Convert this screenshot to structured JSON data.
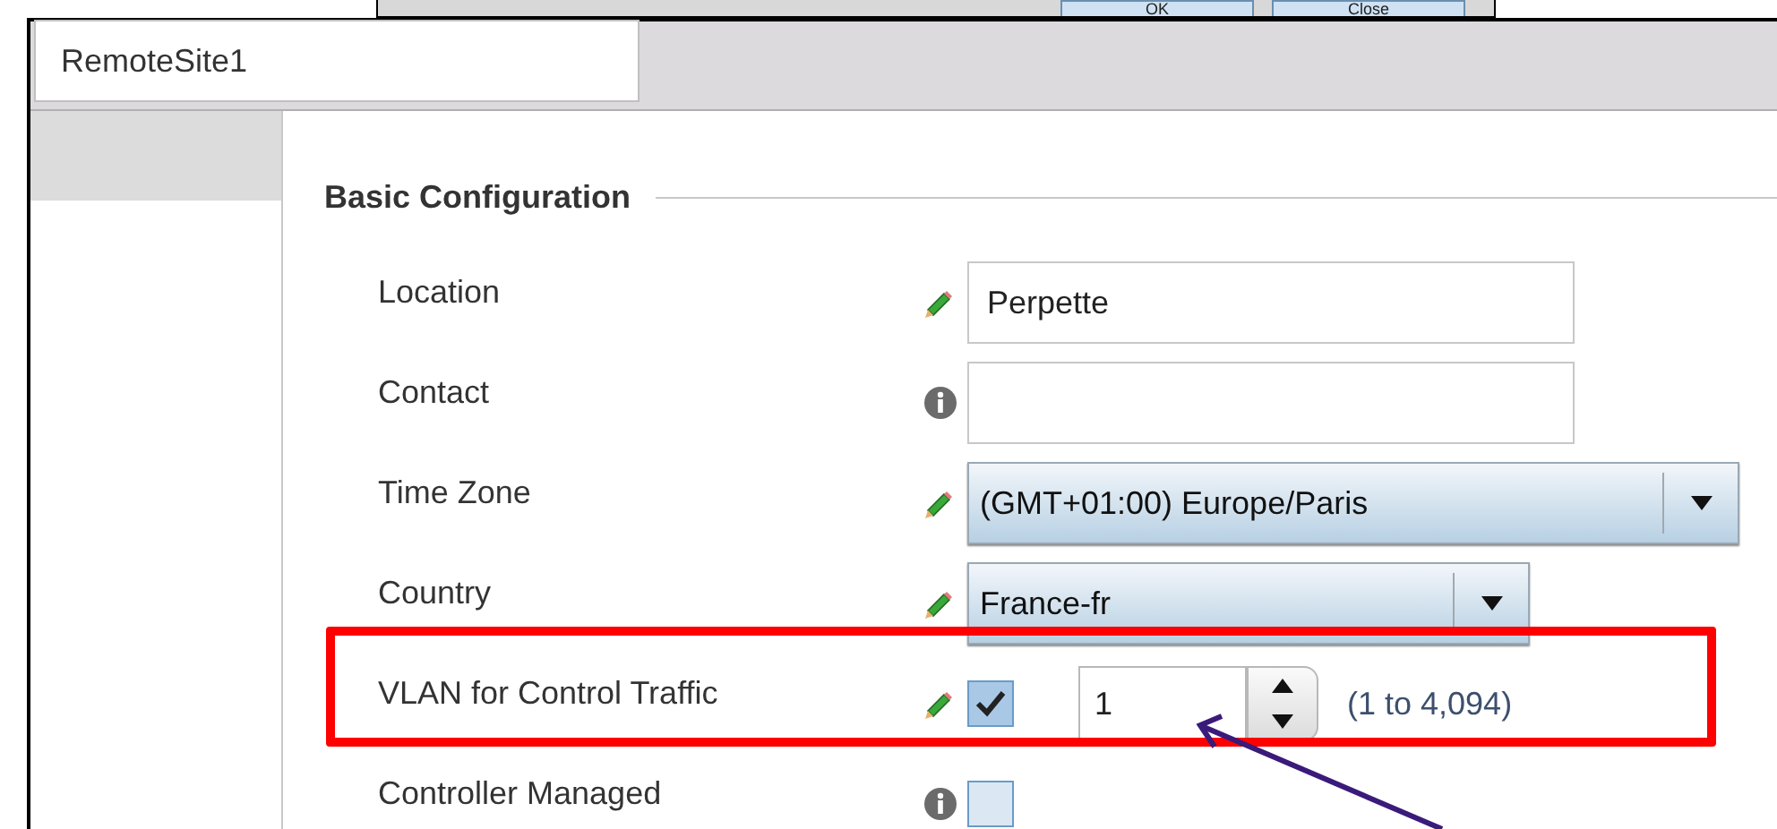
{
  "background_dialog": {
    "buttons": [
      "OK",
      "Close"
    ]
  },
  "tabs": [
    {
      "label": "RemoteSite1",
      "selected": true
    }
  ],
  "section": {
    "title": "Basic Configuration"
  },
  "rows": [
    {
      "label": "Location",
      "kind": "text",
      "editable": true,
      "value": "Perpette"
    },
    {
      "label": "Contact",
      "kind": "text",
      "editable": false,
      "value": ""
    },
    {
      "label": "Time Zone",
      "kind": "select",
      "editable": true,
      "value": "(GMT+01:00) Europe/Paris",
      "wide": true
    },
    {
      "label": "Country",
      "kind": "select",
      "editable": true,
      "value": "France-fr",
      "wide": false
    },
    {
      "label": "VLAN for Control Traffic",
      "kind": "spin",
      "editable": true,
      "checked": true,
      "value": "1",
      "hint": "(1 to 4,094)",
      "highlighted": true
    },
    {
      "label": "Controller Managed",
      "kind": "checkbox",
      "editable": false,
      "checked": false
    }
  ]
}
